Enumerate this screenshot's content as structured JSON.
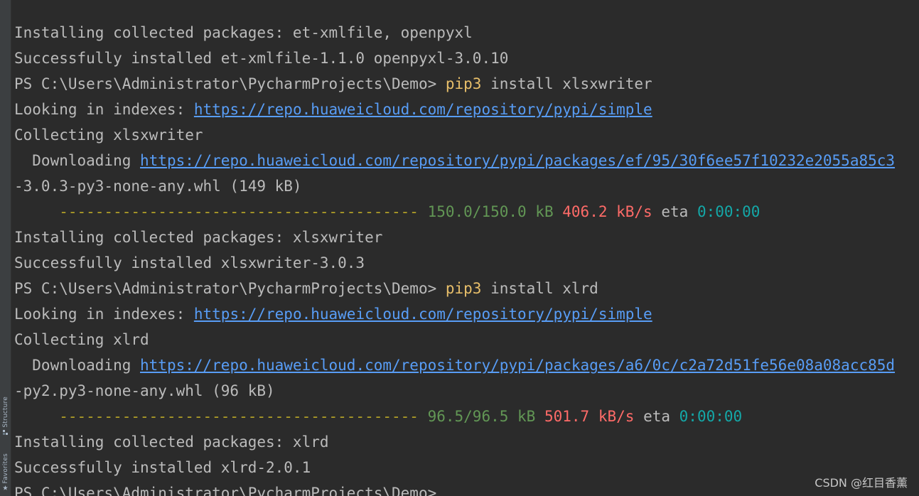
{
  "sidebar": {
    "tabs": [
      {
        "label": "Structure",
        "icon": "structure-icon"
      },
      {
        "label": "Favorites",
        "icon": "star-icon"
      }
    ]
  },
  "terminal": {
    "lines": [
      {
        "type": "plain",
        "text": "  "
      },
      {
        "type": "plain",
        "text": "Installing collected packages: et-xmlfile, openpyxl"
      },
      {
        "type": "plain",
        "text": "Successfully installed et-xmlfile-1.1.0 openpyxl-3.0.10"
      },
      {
        "type": "prompt",
        "prompt": "PS C:\\Users\\Administrator\\PycharmProjects\\Demo> ",
        "cmd": "pip3",
        "args": " install xlsxwriter"
      },
      {
        "type": "index",
        "prefix": "Looking in indexes: ",
        "url": "https://repo.huaweicloud.com/repository/pypi/simple"
      },
      {
        "type": "plain",
        "text": "Collecting xlsxwriter"
      },
      {
        "type": "download",
        "prefix": "  Downloading ",
        "url": "https://repo.huaweicloud.com/repository/pypi/packages/ef/95/30f6ee57f10232e2055a85c3"
      },
      {
        "type": "plain",
        "text": "-3.0.3-py3-none-any.whl (149 kB)"
      },
      {
        "type": "progress",
        "bar": "     ---------------------------------------- ",
        "size": "150.0/150.0 kB",
        "speed": "406.2 kB/s",
        "eta_label": "eta",
        "eta": "0:00:00"
      },
      {
        "type": "plain",
        "text": "Installing collected packages: xlsxwriter"
      },
      {
        "type": "plain",
        "text": "Successfully installed xlsxwriter-3.0.3"
      },
      {
        "type": "prompt",
        "prompt": "PS C:\\Users\\Administrator\\PycharmProjects\\Demo> ",
        "cmd": "pip3",
        "args": " install xlrd"
      },
      {
        "type": "index",
        "prefix": "Looking in indexes: ",
        "url": "https://repo.huaweicloud.com/repository/pypi/simple"
      },
      {
        "type": "plain",
        "text": "Collecting xlrd"
      },
      {
        "type": "download",
        "prefix": "  Downloading ",
        "url": "https://repo.huaweicloud.com/repository/pypi/packages/a6/0c/c2a72d51fe56e08a08acc85d"
      },
      {
        "type": "plain",
        "text": "-py2.py3-none-any.whl (96 kB)"
      },
      {
        "type": "progress",
        "bar": "     ---------------------------------------- ",
        "size": "96.5/96.5 kB",
        "speed": "501.7 kB/s",
        "eta_label": "eta",
        "eta": "0:00:00"
      },
      {
        "type": "plain",
        "text": "Installing collected packages: xlrd"
      },
      {
        "type": "plain",
        "text": "Successfully installed xlrd-2.0.1"
      },
      {
        "type": "prompt",
        "prompt": "PS C:\\Users\\Administrator\\PycharmProjects\\Demo>",
        "cmd": "",
        "args": ""
      }
    ]
  },
  "watermark": "CSDN @红目香薰",
  "colors": {
    "background": "#2b2b2b",
    "text": "#bbbbbb",
    "link": "#589df6",
    "command": "#e8bf6a",
    "progress_bar": "#b4a227",
    "size": "#629755",
    "speed": "#ff6b68",
    "eta": "#14a8a8"
  }
}
